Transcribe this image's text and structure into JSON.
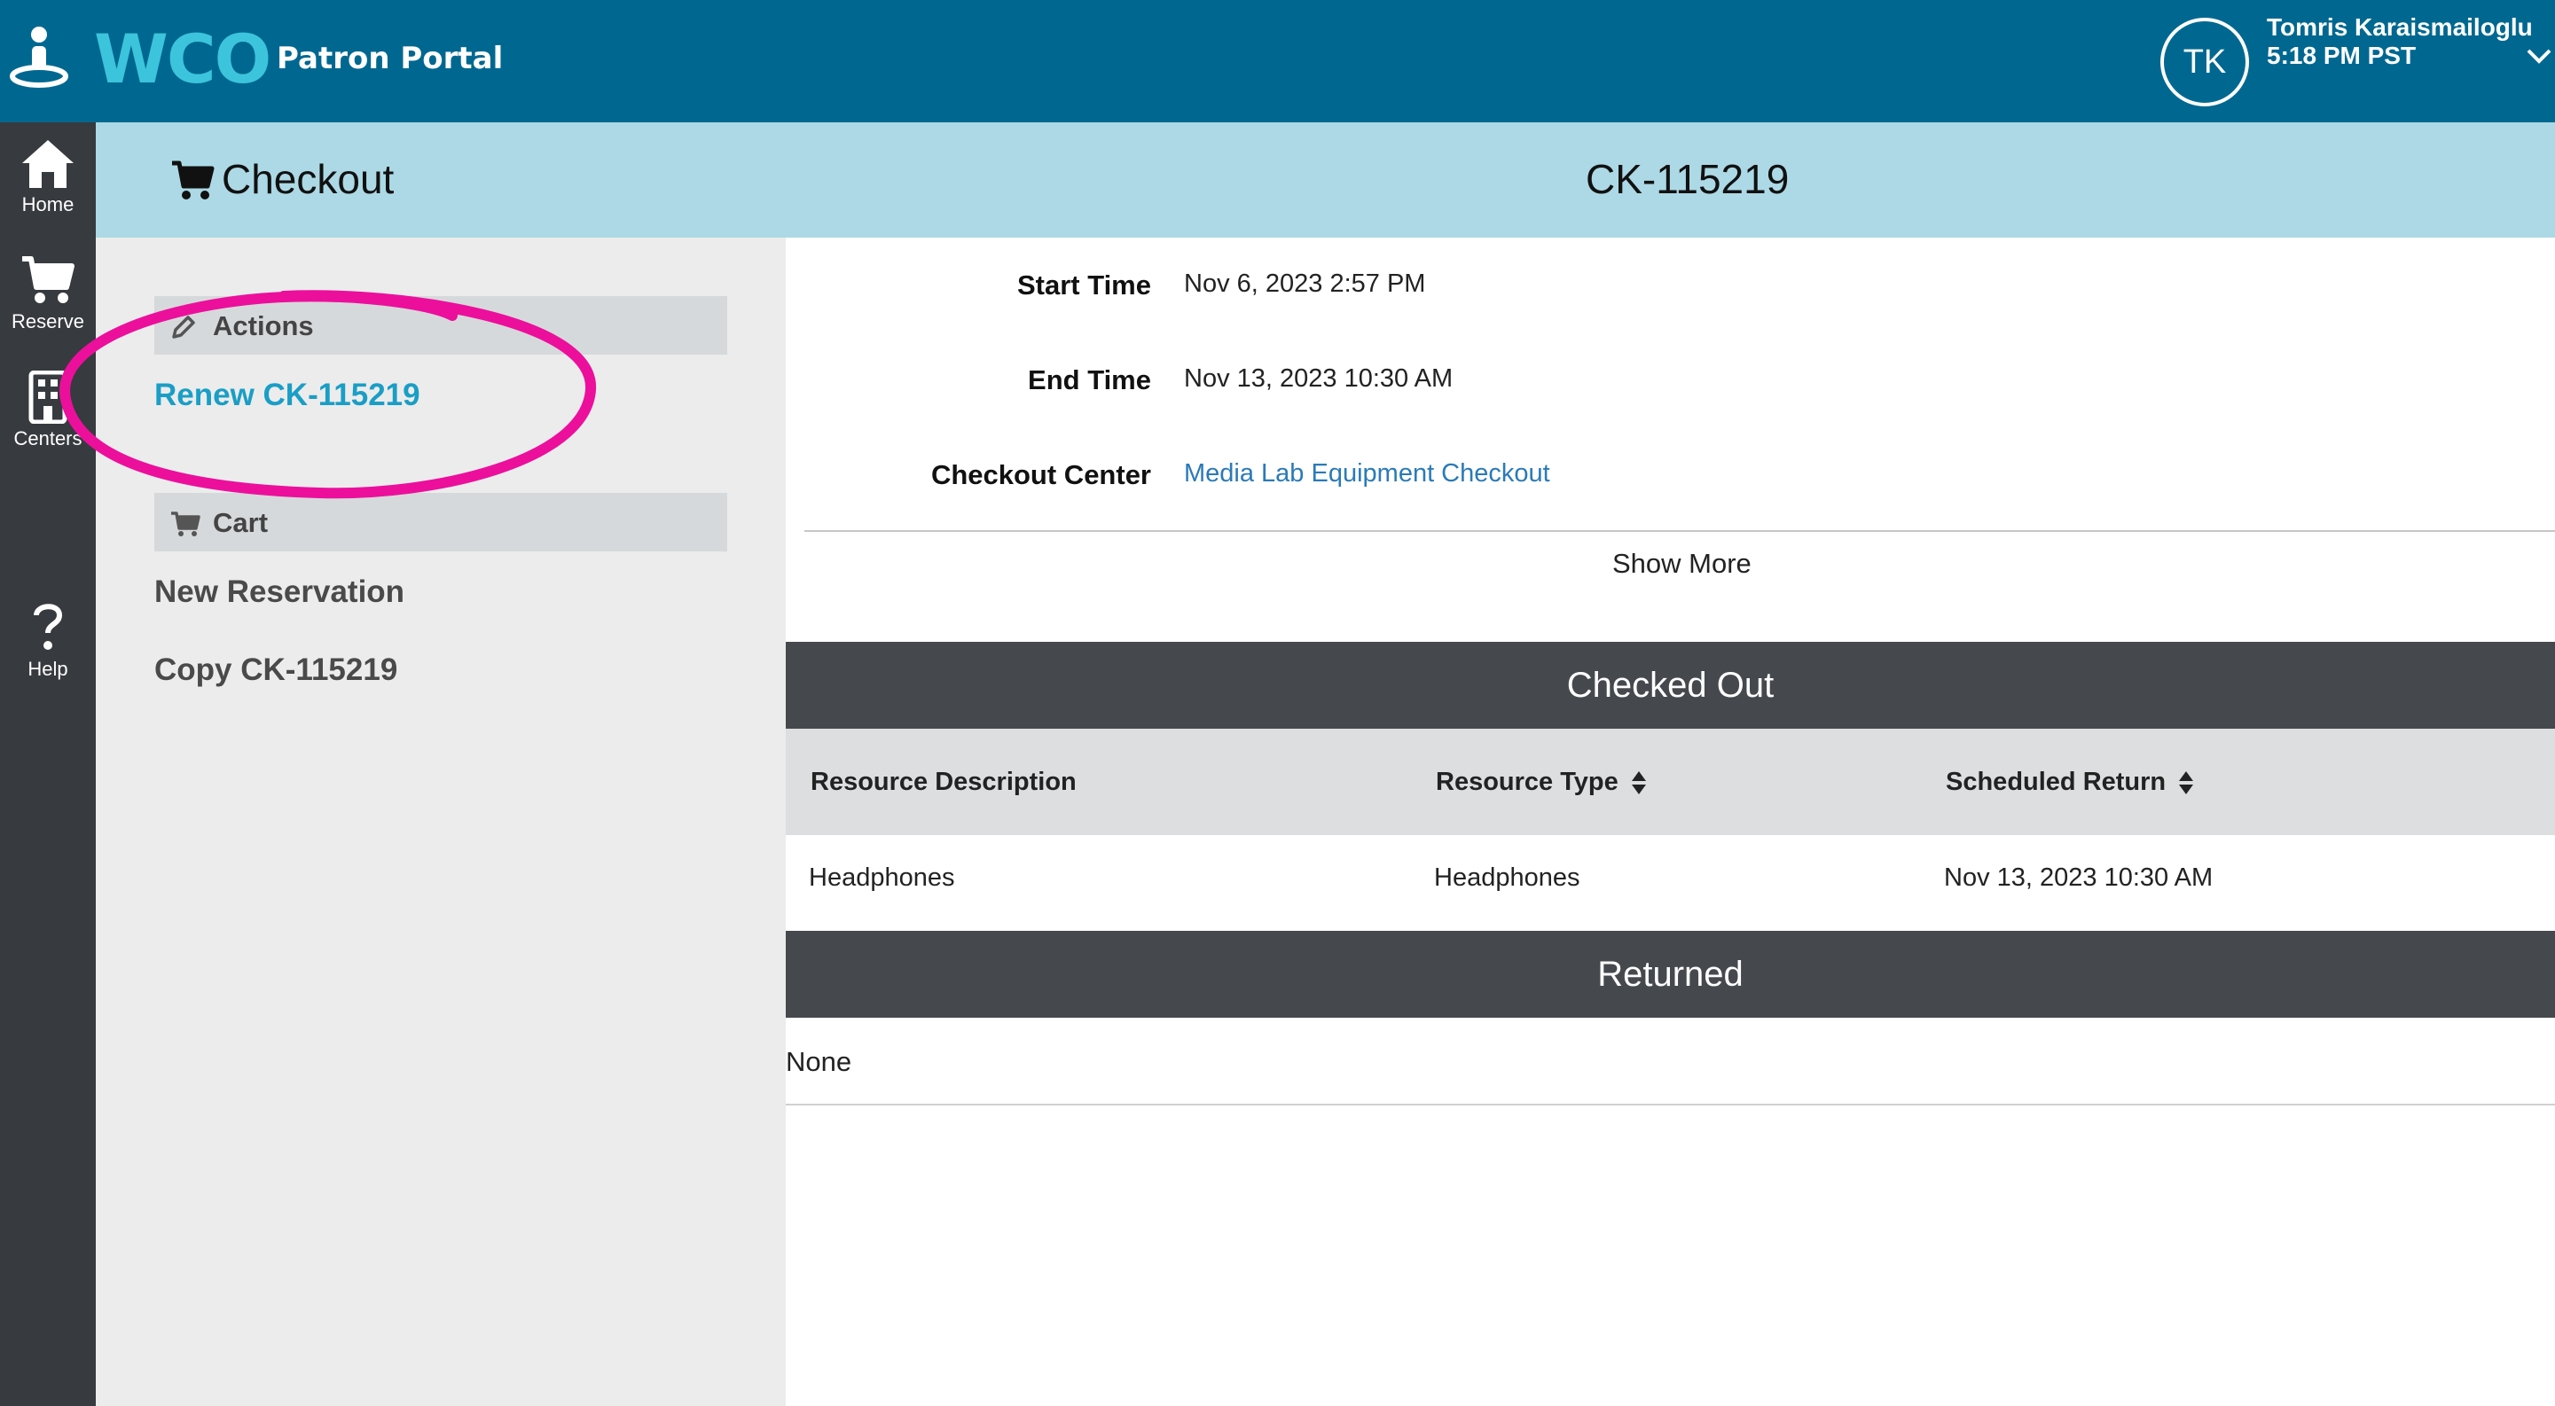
{
  "header": {
    "logo_text": "WCO",
    "portal_label": "Patron Portal",
    "user_initials": "TK",
    "user_name": "Tomris Karaismailoglu",
    "user_time": "5:18 PM PST"
  },
  "sidebar": {
    "items": [
      {
        "label": "Home",
        "icon": "home-icon"
      },
      {
        "label": "Reserve",
        "icon": "cart-icon"
      },
      {
        "label": "Centers",
        "icon": "building-icon"
      },
      {
        "label": "Help",
        "icon": "question-icon"
      }
    ]
  },
  "page": {
    "title": "Checkout",
    "id": "CK-115219"
  },
  "actions": {
    "header": "Actions",
    "renew": "Renew CK-115219",
    "cart_header": "Cart",
    "new_reservation": "New Reservation",
    "copy": "Copy CK-115219"
  },
  "details": {
    "start_label": "Start Time",
    "start_value": "Nov 6, 2023 2:57 PM",
    "end_label": "End Time",
    "end_value": "Nov 13, 2023 10:30 AM",
    "center_label": "Checkout Center",
    "center_value": "Media Lab Equipment Checkout",
    "show_more": "Show More"
  },
  "checked_out": {
    "title": "Checked Out",
    "columns": [
      "Resource Description",
      "Resource Type",
      "Scheduled Return"
    ],
    "rows": [
      [
        "Headphones",
        "Headphones",
        "Nov 13, 2023 10:30 AM"
      ]
    ]
  },
  "returned": {
    "title": "Returned",
    "empty_text": "None"
  },
  "colors": {
    "header_bg": "#006890",
    "logo_accent": "#3cc4dc",
    "sidebar_bg": "#373a3e",
    "title_bar_bg": "#acd9e5",
    "link_teal": "#1a9ec5",
    "annotation_magenta": "#ec0f9c"
  }
}
